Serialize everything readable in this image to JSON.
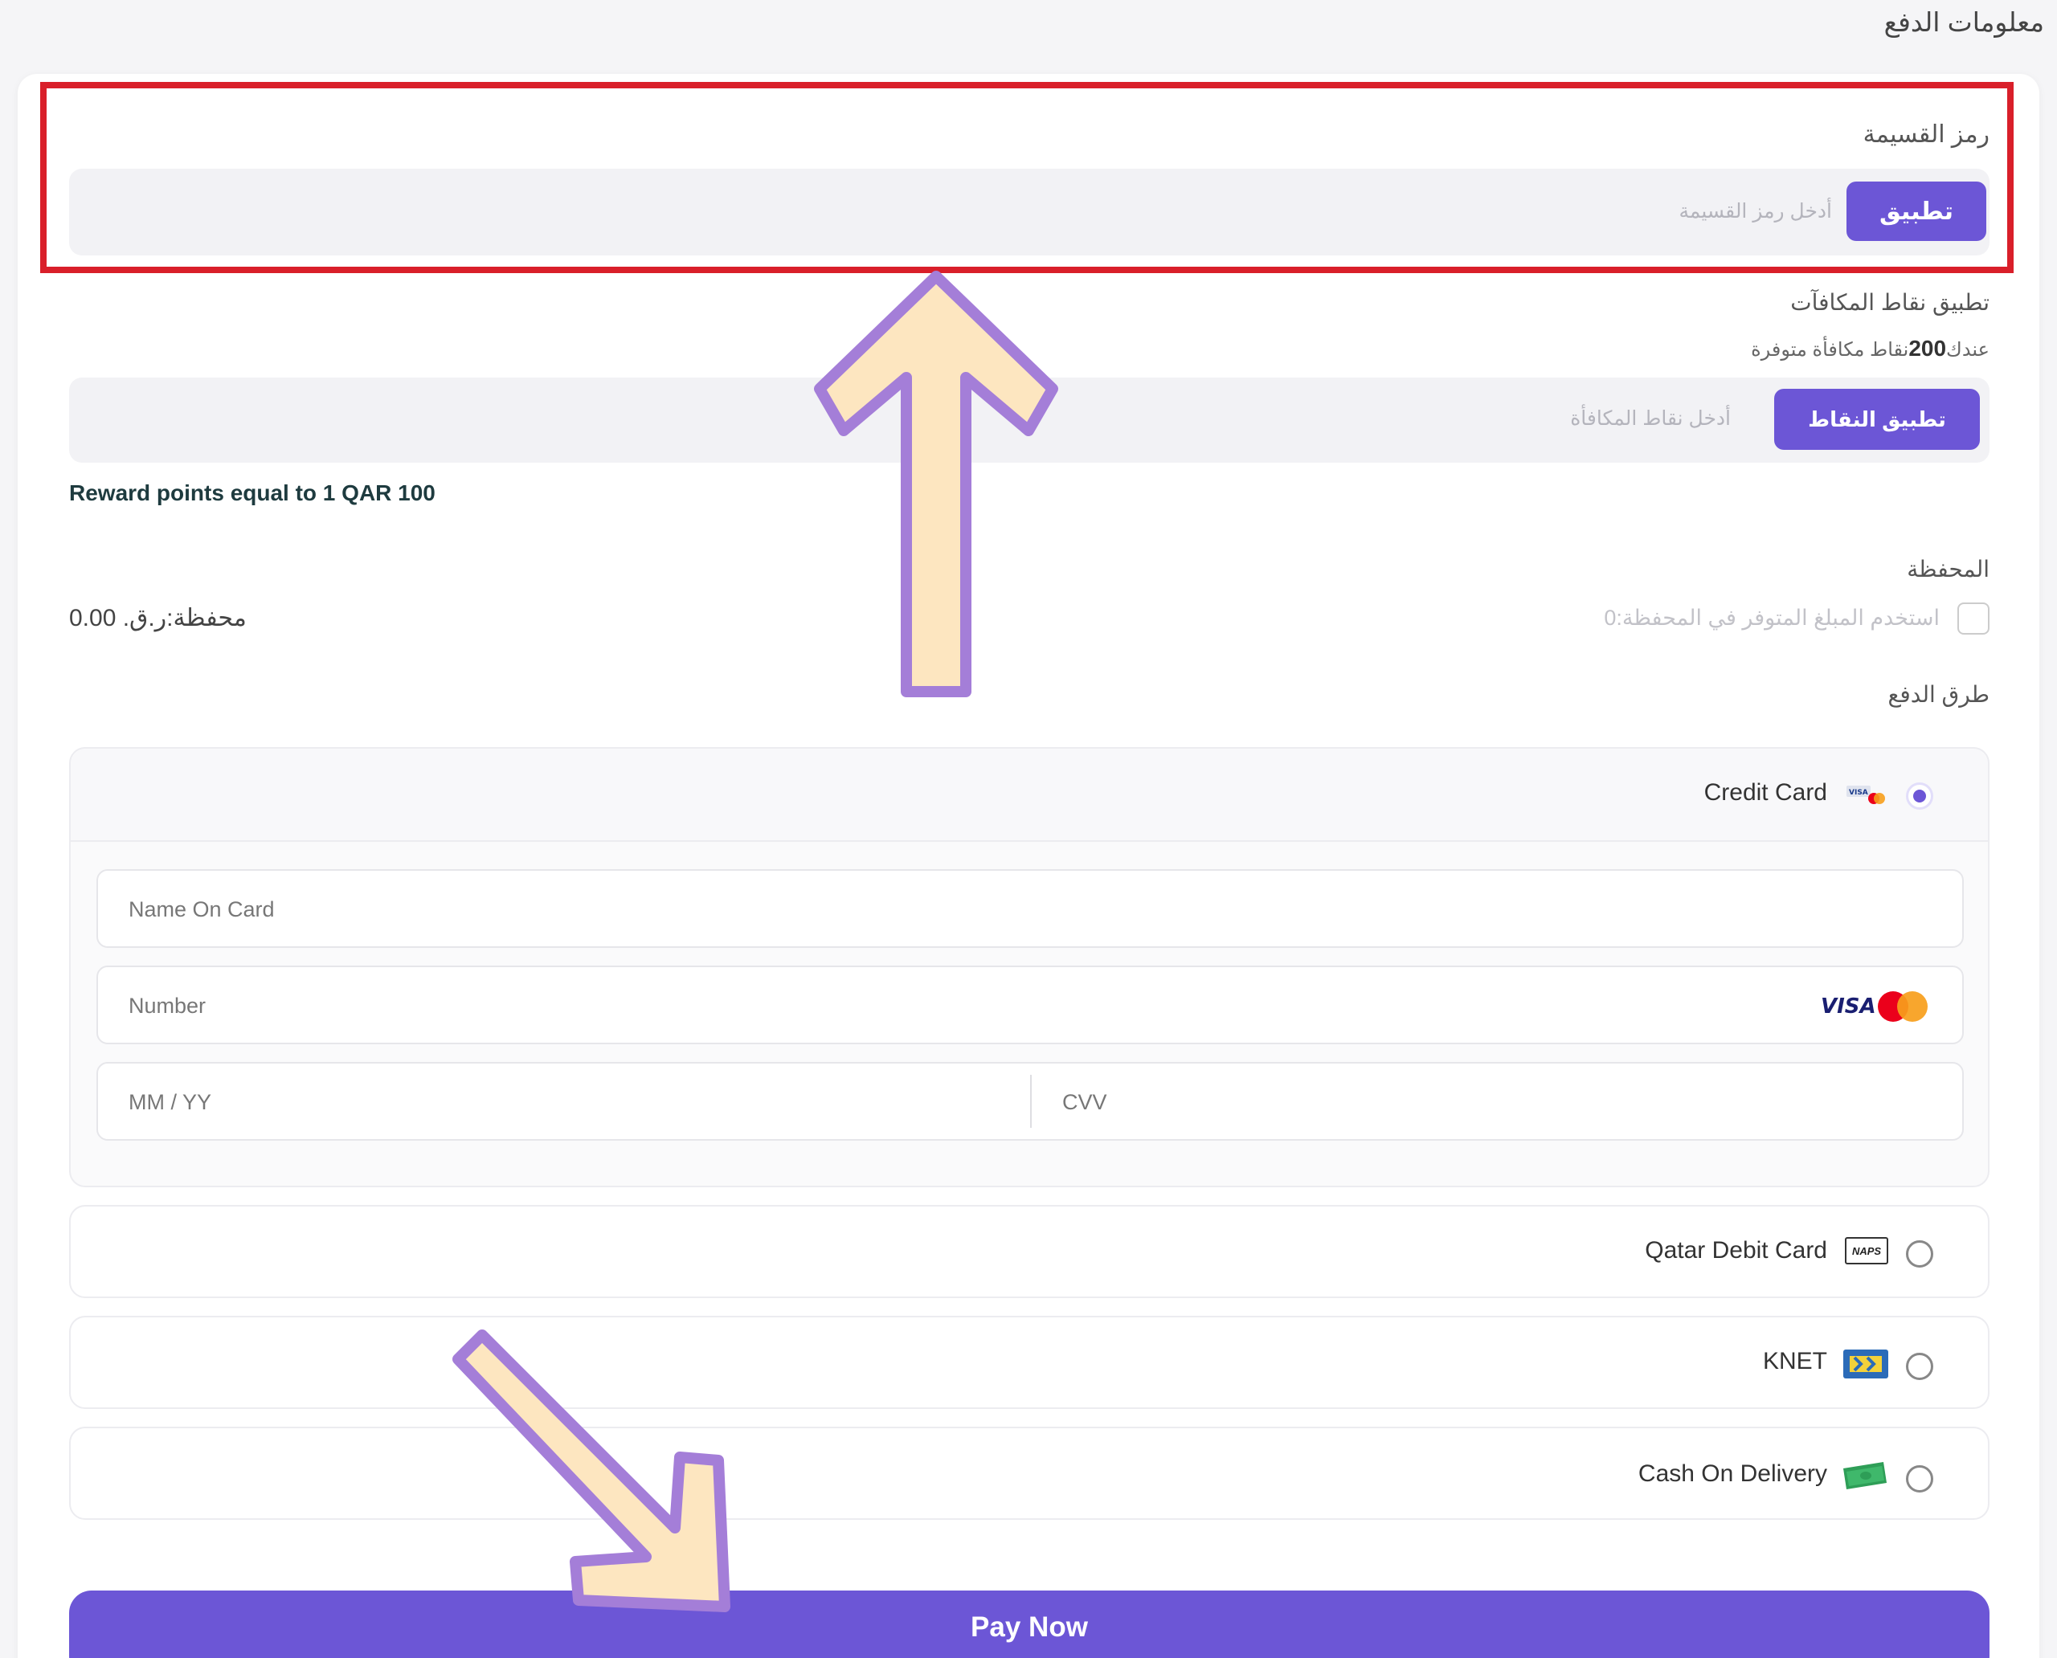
{
  "page": {
    "title": "معلومات الدفع"
  },
  "coupon": {
    "label": "رمز القسيمة",
    "placeholder": "أدخل رمز القسيمة",
    "apply_label": "تطبيق"
  },
  "rewards": {
    "label": "تطبيق نقاط المكافآت",
    "available_prefix": "عندك",
    "available_points": "200",
    "available_suffix": "نقاط مكافأة متوفرة",
    "placeholder": "أدخل نقاط المكافأة",
    "apply_label": "تطبيق النقاط",
    "note": "Reward points equal to 1 QAR 100"
  },
  "wallet": {
    "label": "المحفظة",
    "checkbox_text": "استخدم المبلغ المتوفر في المحفظة:0",
    "balance_text": "محفظة:ر.ق. 0.00"
  },
  "payment_methods": {
    "label": "طرق الدفع",
    "credit_card": {
      "label": "Credit Card",
      "name_placeholder": "Name On Card",
      "number_placeholder": "Number",
      "expiry_placeholder": "MM / YY",
      "cvv_placeholder": "CVV",
      "visa_text": "VISA"
    },
    "qatar_debit": {
      "label": "Qatar Debit Card",
      "badge": "NAPS"
    },
    "knet": {
      "label": "KNET"
    },
    "cod": {
      "label": "Cash On Delivery"
    }
  },
  "pay_button": {
    "label": "Pay Now"
  },
  "colors": {
    "accent": "#6c56d6",
    "highlight": "#d91f2a",
    "arrow_fill": "#fde6c0",
    "arrow_stroke": "#a47ed8"
  },
  "icons": {
    "credit": "credit-card-brands-icon",
    "naps": "naps-icon",
    "knet": "knet-icon",
    "cash": "cash-icon",
    "annotation_up": "annotation-arrow-up",
    "annotation_down": "annotation-arrow-down-right"
  }
}
